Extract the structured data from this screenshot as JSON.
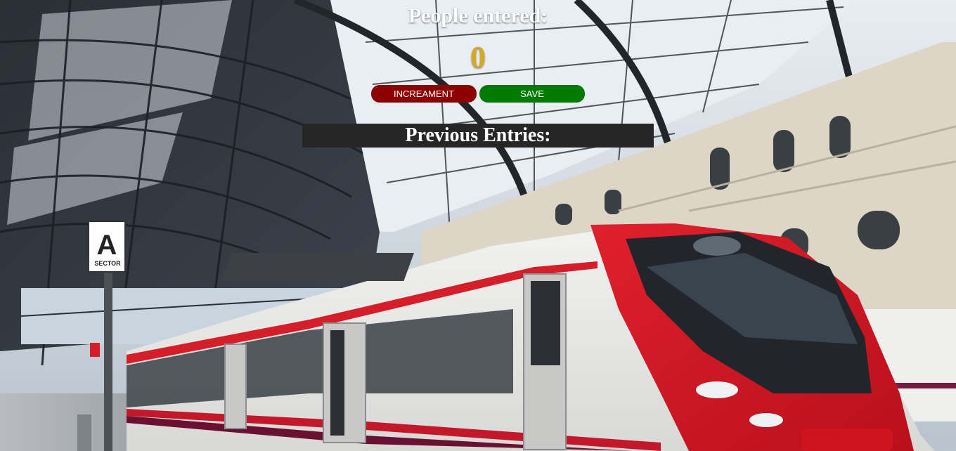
{
  "header": {
    "title": "People entered:"
  },
  "counter": {
    "value": "0"
  },
  "buttons": {
    "increment_label": "INCREAMENT",
    "save_label": "SAVE"
  },
  "entries": {
    "heading": "Previous Entries:"
  },
  "background": {
    "sign_letter": "A",
    "sign_caption": "SECTOR"
  },
  "colors": {
    "count": "#d6a91e",
    "increment_button": "#8c0000",
    "save_button": "#007a00",
    "entries_bar": "#262626"
  }
}
